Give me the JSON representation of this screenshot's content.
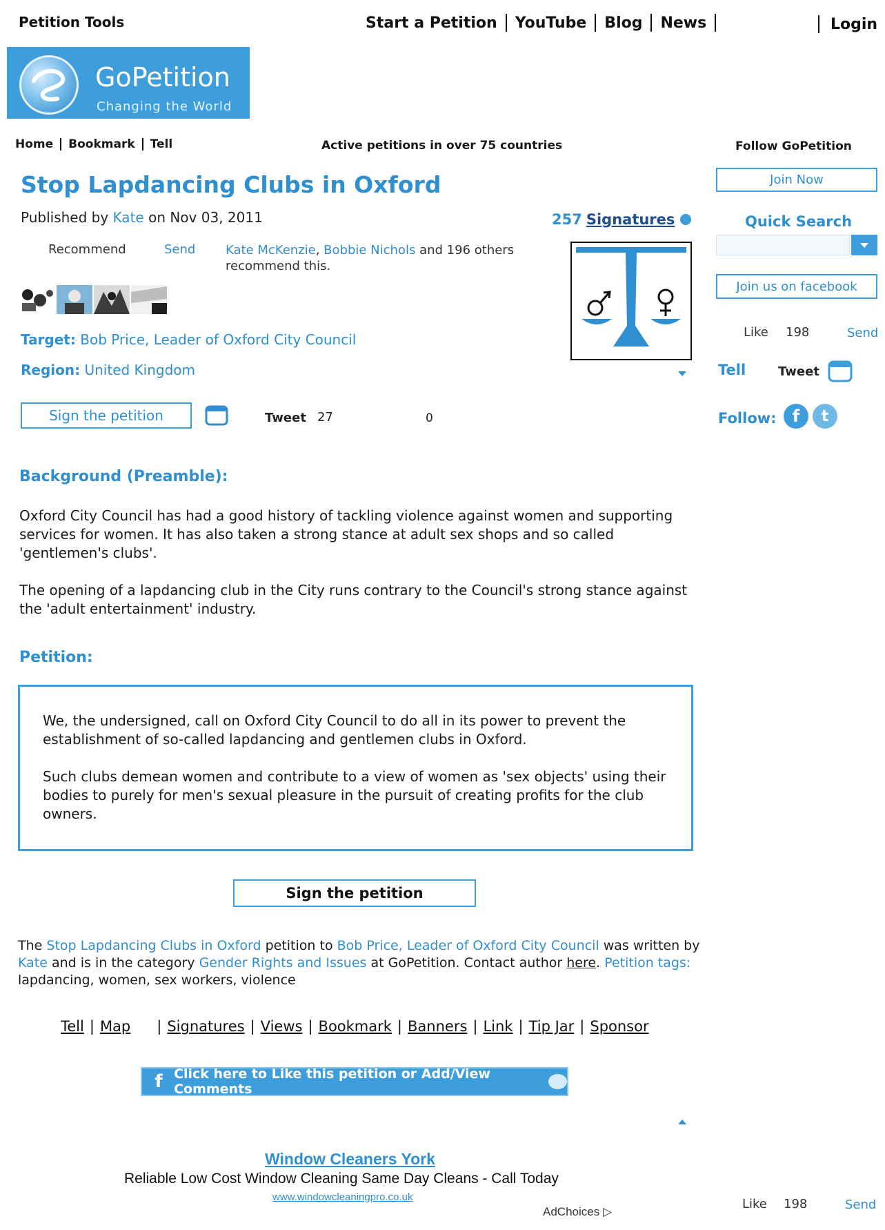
{
  "topbar": {
    "tools_title": "Petition Tools",
    "nav": [
      "Start a Petition",
      "YouTube",
      "Blog",
      "News"
    ],
    "login": "Login"
  },
  "logo": {
    "brand": "GoPetition",
    "slogan": "Changing the World"
  },
  "subnav": {
    "items": [
      "Home",
      "Bookmark",
      "Tell"
    ],
    "active_text": "Active petitions in over 75 countries",
    "follow_text": "Follow GoPetition"
  },
  "petition": {
    "title": "Stop Lapdancing Clubs in Oxford",
    "published_prefix": "Published by",
    "author": "Kate",
    "published_suffix": "on Nov 03, 2011",
    "signature_count": "257",
    "signatures_label": "Signatures",
    "recommend_label": "Recommend",
    "send_label": "Send",
    "recommenders": [
      "Kate McKenzie",
      "Bobbie Nichols"
    ],
    "recommend_rest": "and 196 others recommend this.",
    "target_label": "Target:",
    "target_value": "Bob Price, Leader of Oxford City Council",
    "region_label": "Region:",
    "region_value": "United Kingdom",
    "sign_button": "Sign the petition",
    "tweet_label": "Tweet",
    "tweet_count": "27",
    "other_count": "0"
  },
  "background": {
    "heading": "Background (Preamble):",
    "paragraphs": [
      "Oxford City Council has had a good history of tackling violence against women and supporting services for women. It has also taken a strong stance at adult sex shops and so called 'gentlemen's clubs'.",
      "The opening of a lapdancing club in the City runs contrary to the Council's strong stance against the 'adult entertainment' industry."
    ]
  },
  "petition_text": {
    "heading": "Petition:",
    "paragraphs": [
      "We, the undersigned, call on Oxford City Council to do all in its power to prevent the establishment of so-called lapdancing and gentlemen clubs in Oxford.",
      "Such clubs demean women and contribute to a view of women as 'sex objects' using their bodies to purely for men's sexual pleasure in the pursuit of creating profits for the club owners."
    ],
    "sign_button": "Sign the petition"
  },
  "summary": {
    "t1": "The",
    "petition_link": "Stop Lapdancing Clubs in Oxford",
    "t2": "petition to",
    "target_link": "Bob Price, Leader of Oxford City Council",
    "t3": "was written by",
    "author_link": "Kate",
    "t4": "and is in the category",
    "category_link": "Gender Rights and Issues",
    "t5": "at GoPetition. Contact author",
    "here_link": "here",
    "t6": ".",
    "tags_label": "Petition tags:",
    "tags": "lapdancing, women, sex workers, violence"
  },
  "footer_links": {
    "group1": [
      "Tell",
      "Map"
    ],
    "group2": [
      "Signatures",
      "Views",
      "Bookmark",
      "Banners",
      "Link",
      "Tip Jar",
      "Sponsor"
    ]
  },
  "facebook_bar": "Click here to Like this petition or Add/View Comments",
  "ad": {
    "title": "Window Cleaners York",
    "description": "Reliable Low Cost Window Cleaning Same Day Cleans - Call Today",
    "url": "www.windowcleaningpro.co.uk",
    "adchoices": "AdChoices"
  },
  "sidebar": {
    "join_now": "Join Now",
    "quick_search": "Quick Search",
    "join_facebook": "Join us on facebook",
    "like_label": "Like",
    "like_count": "198",
    "send_label": "Send",
    "tell_label": "Tell",
    "tweet_label": "Tweet",
    "follow_label": "Follow:"
  },
  "colors": {
    "accent": "#2f8fd0",
    "brand_bg": "#3e9ddb"
  }
}
